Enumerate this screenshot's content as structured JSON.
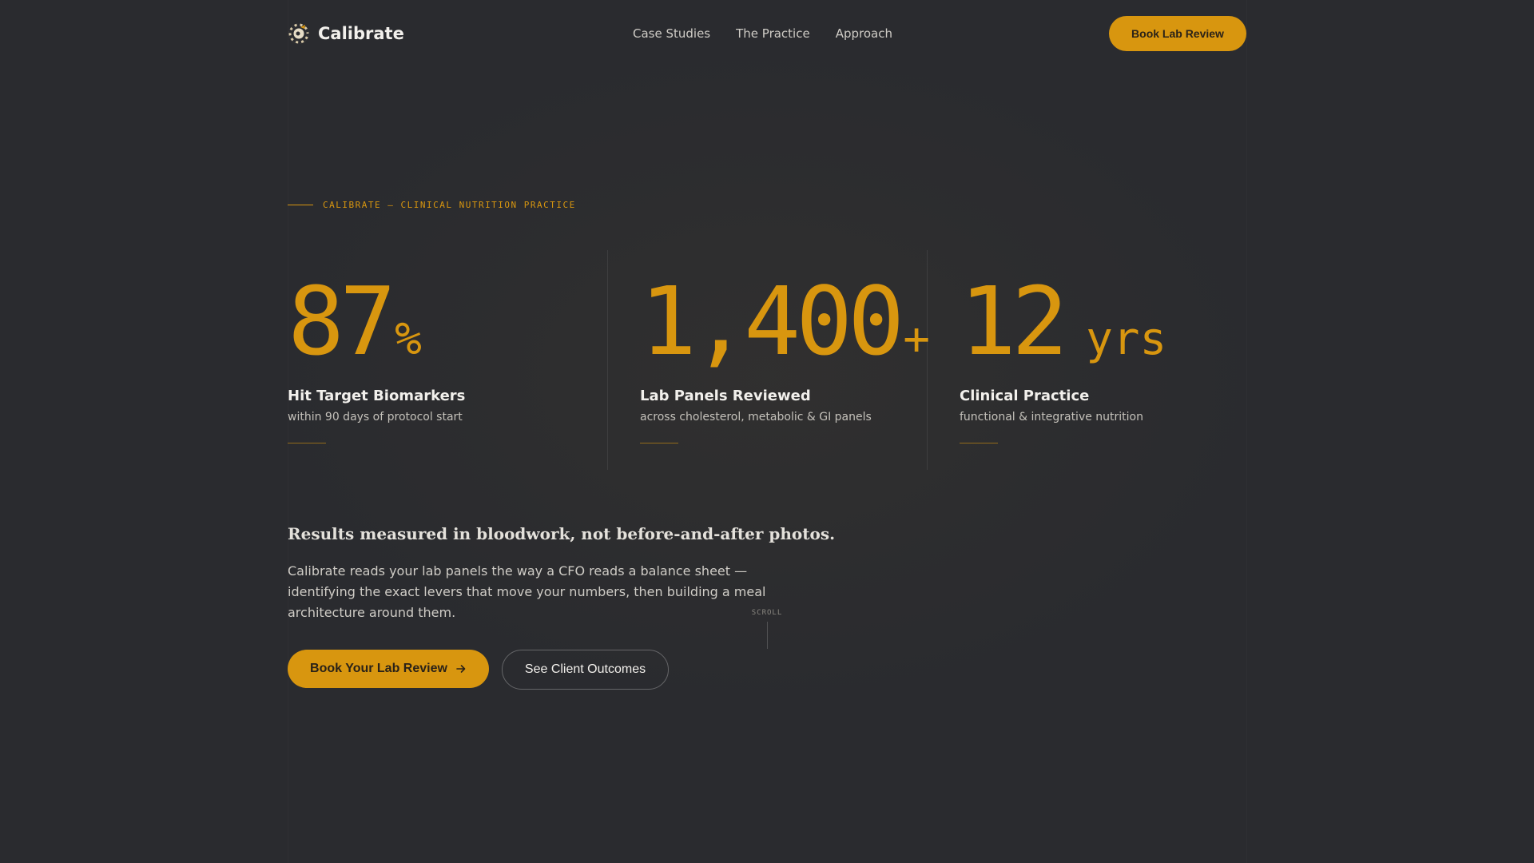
{
  "brand": {
    "name": "Calibrate",
    "logo_icon": "calibration-dial-icon"
  },
  "nav": {
    "items": [
      {
        "label": "Case Studies"
      },
      {
        "label": "The Practice"
      },
      {
        "label": "Approach"
      }
    ],
    "cta_label": "Book Lab Review"
  },
  "hero": {
    "eyebrow": "CALIBRATE — CLINICAL NUTRITION PRACTICE",
    "stats": [
      {
        "number": "87",
        "unit": "%",
        "label": "Hit Target Biomarkers",
        "sub": "within 90 days of protocol start"
      },
      {
        "number": "1,400",
        "unit": "+",
        "label": "Lab Panels Reviewed",
        "sub": "across cholesterol, metabolic & GI panels"
      },
      {
        "number": "12",
        "unit": "yrs",
        "label": "Clinical Practice",
        "sub": "functional & integrative nutrition"
      }
    ],
    "headline": "Results measured in bloodwork, not before-and-after photos.",
    "body": "Calibrate reads your lab panels the way a CFO reads a balance sheet — identifying the exact levers that move your numbers, then building a meal architecture around them.",
    "primary_cta": "Book Your Lab Review",
    "primary_cta_icon": "arrow-right-icon",
    "secondary_cta": "See Client Outcomes",
    "scroll_label": "SCROLL"
  },
  "colors": {
    "background": "#2a2b2f",
    "accent": "#d8960f",
    "text": "#f2f0ec"
  }
}
